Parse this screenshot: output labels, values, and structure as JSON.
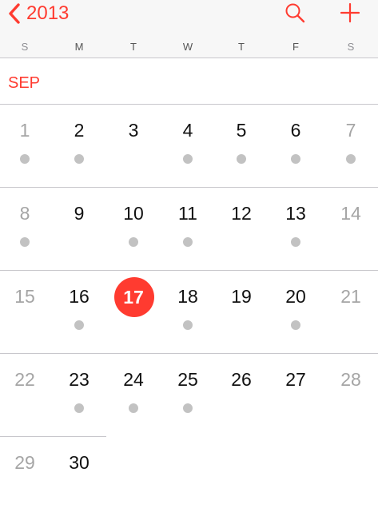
{
  "nav": {
    "back_label": "2013",
    "back_icon": "chevron-left-icon",
    "search_icon": "search-icon",
    "add_icon": "plus-icon"
  },
  "weekdays": [
    "S",
    "M",
    "T",
    "W",
    "T",
    "F",
    "S"
  ],
  "month": {
    "label": "SEP"
  },
  "today": 17,
  "weeks": [
    [
      {
        "day": "1",
        "weekend": true,
        "dot": true
      },
      {
        "day": "2",
        "weekend": false,
        "dot": true
      },
      {
        "day": "3",
        "weekend": false,
        "dot": false
      },
      {
        "day": "4",
        "weekend": false,
        "dot": true
      },
      {
        "day": "5",
        "weekend": false,
        "dot": true
      },
      {
        "day": "6",
        "weekend": false,
        "dot": true
      },
      {
        "day": "7",
        "weekend": true,
        "dot": true
      }
    ],
    [
      {
        "day": "8",
        "weekend": true,
        "dot": true
      },
      {
        "day": "9",
        "weekend": false,
        "dot": false
      },
      {
        "day": "10",
        "weekend": false,
        "dot": true
      },
      {
        "day": "11",
        "weekend": false,
        "dot": true
      },
      {
        "day": "12",
        "weekend": false,
        "dot": false
      },
      {
        "day": "13",
        "weekend": false,
        "dot": true
      },
      {
        "day": "14",
        "weekend": true,
        "dot": false
      }
    ],
    [
      {
        "day": "15",
        "weekend": true,
        "dot": false
      },
      {
        "day": "16",
        "weekend": false,
        "dot": true
      },
      {
        "day": "17",
        "weekend": false,
        "dot": false,
        "today": true
      },
      {
        "day": "18",
        "weekend": false,
        "dot": true
      },
      {
        "day": "19",
        "weekend": false,
        "dot": false
      },
      {
        "day": "20",
        "weekend": false,
        "dot": true
      },
      {
        "day": "21",
        "weekend": true,
        "dot": false
      }
    ],
    [
      {
        "day": "22",
        "weekend": true,
        "dot": false
      },
      {
        "day": "23",
        "weekend": false,
        "dot": true
      },
      {
        "day": "24",
        "weekend": false,
        "dot": true
      },
      {
        "day": "25",
        "weekend": false,
        "dot": true
      },
      {
        "day": "26",
        "weekend": false,
        "dot": false
      },
      {
        "day": "27",
        "weekend": false,
        "dot": false
      },
      {
        "day": "28",
        "weekend": true,
        "dot": false
      }
    ],
    [
      {
        "day": "29",
        "weekend": true,
        "dot": false
      },
      {
        "day": "30",
        "weekend": false,
        "dot": false
      }
    ]
  ],
  "colors": {
    "accent": "#ff3b30",
    "text": "#111111",
    "weekend_text": "#a5a5a5",
    "weekday_header_text": "#555555",
    "weekend_header_text": "#8e8e93",
    "dot": "#c2c2c2",
    "today_text": "#ffffff"
  }
}
